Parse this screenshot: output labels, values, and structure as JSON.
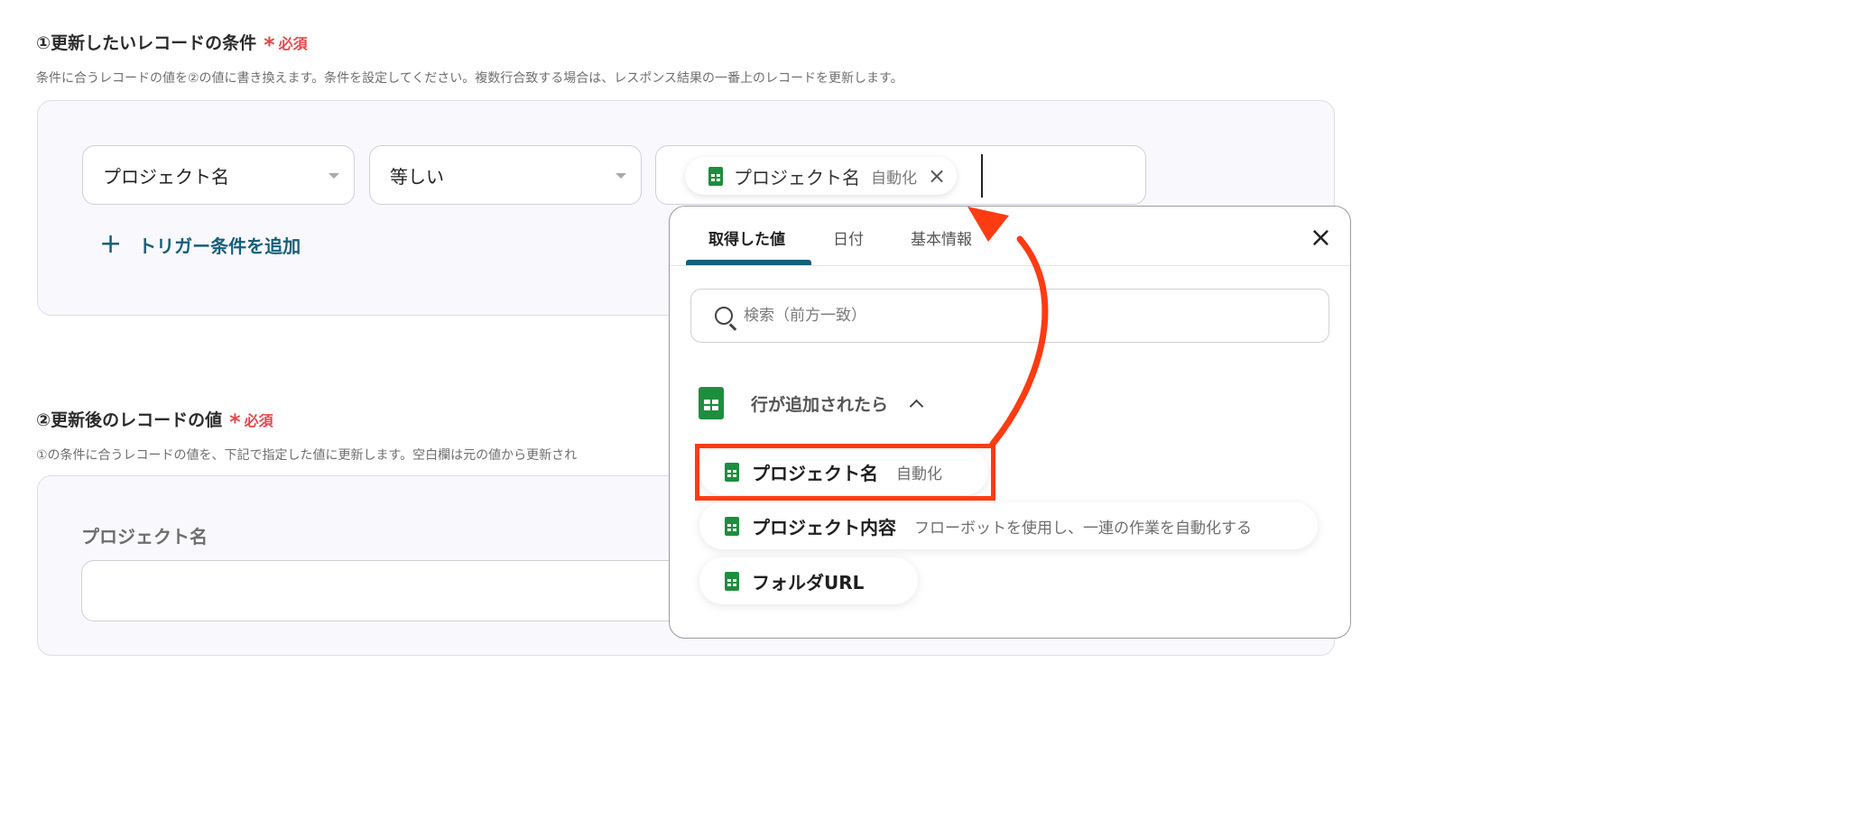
{
  "section1": {
    "title": "①更新したいレコードの条件",
    "required_star": "*",
    "required_label": "必須",
    "description": "条件に合うレコードの値を②の値に書き換えます。条件を設定してください。複数行合致する場合は、レスポンス結果の一番上のレコードを更新します。"
  },
  "condition": {
    "field_select": "プロジェクト名",
    "operator_select": "等しい",
    "value_chip": {
      "name": "プロジェクト名",
      "hint": "自動化",
      "remove": "×"
    },
    "add_trigger": {
      "plus": "+",
      "label": "トリガー条件を追加"
    }
  },
  "section2": {
    "title": "②更新後のレコードの値",
    "required_star": "*",
    "required_label": "必須",
    "description": "①の条件に合うレコードの値を、下記で指定した値に更新します。空白欄は元の値から更新され",
    "field_label": "プロジェクト名",
    "field_value": ""
  },
  "popup": {
    "tabs": [
      "取得した値",
      "日付",
      "基本情報"
    ],
    "active_tab": 0,
    "close": "×",
    "search_placeholder": "検索（前方一致）",
    "group_label": "行が追加されたら",
    "items": [
      {
        "name": "プロジェクト名",
        "hint": "自動化"
      },
      {
        "name": "プロジェクト内容",
        "hint": "フローボットを使用し、一連の作業を自動化する"
      },
      {
        "name": "フォルダURL",
        "hint": ""
      }
    ]
  },
  "colors": {
    "accent": "#155e7a",
    "required": "#e5484d",
    "annotation": "#ff3b12",
    "sheets_green": "#1e8e3e"
  },
  "icons": [
    "google-sheets-icon",
    "search-icon",
    "close-icon",
    "chevron-up-icon",
    "plus-icon"
  ]
}
